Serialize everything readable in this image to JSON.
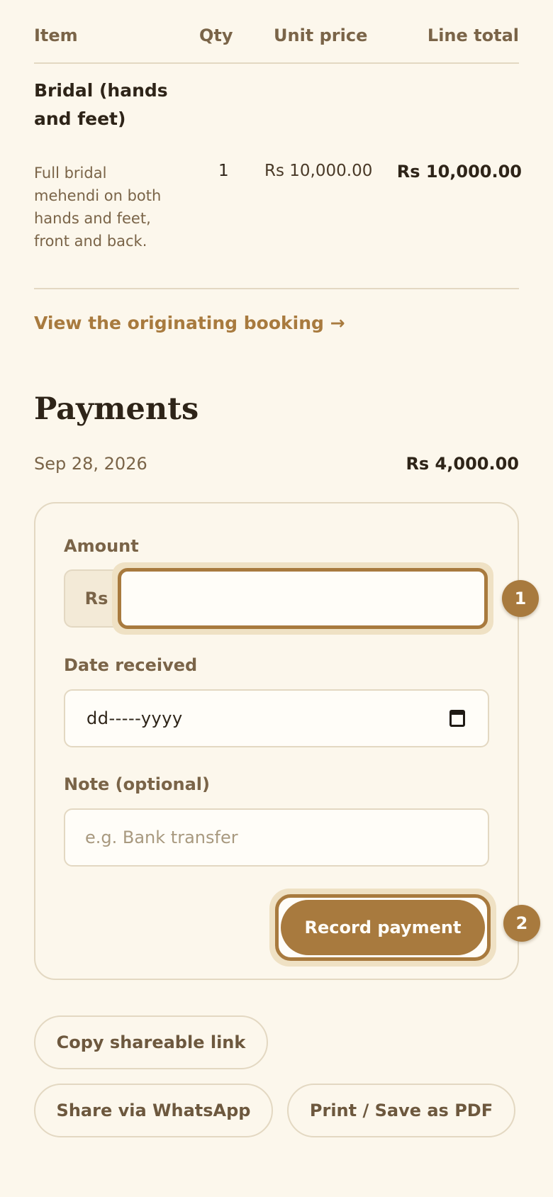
{
  "table": {
    "headers": {
      "item": "Item",
      "qty": "Qty",
      "unit_price": "Unit price",
      "line_total": "Line total"
    },
    "rows": [
      {
        "name": "Bridal (hands and feet)",
        "description": "Full bridal mehendi on both hands and feet, front and back.",
        "qty": "1",
        "unit_price": "Rs 10,000.00",
        "line_total": "Rs 10,000.00"
      }
    ]
  },
  "booking_link": "View the originating booking →",
  "payments": {
    "title": "Payments",
    "entries": [
      {
        "date": "Sep 28, 2026",
        "amount": "Rs 4,000.00"
      }
    ]
  },
  "form": {
    "amount_label": "Amount",
    "currency_prefix": "Rs",
    "amount_value": "",
    "date_label": "Date received",
    "date_placeholder": "dd-----yyyy",
    "note_label": "Note (optional)",
    "note_placeholder": "e.g. Bank transfer",
    "submit_label": "Record payment"
  },
  "markers": {
    "first": "1",
    "second": "2"
  },
  "actions": {
    "copy_link": "Copy shareable link",
    "whatsapp": "Share via WhatsApp",
    "print": "Print / Save as PDF"
  },
  "colors": {
    "accent": "#a87a3e",
    "background": "#fcf7ec",
    "border": "#e3d8c2"
  }
}
